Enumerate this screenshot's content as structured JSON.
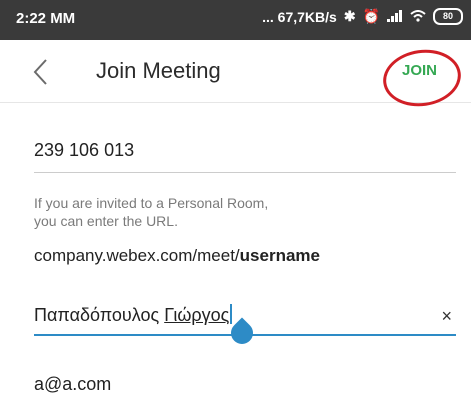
{
  "status_bar": {
    "time": "2:22 MM",
    "network_info": "... 67,7KB/s",
    "battery": "80"
  },
  "header": {
    "back_icon": "chevron-left-icon",
    "title": "Join Meeting",
    "join_label": "JOIN",
    "join_highlight_color": "#d11f26",
    "join_color": "#35a853"
  },
  "form": {
    "meeting_number": "239 106 013",
    "hint_line1": "If you are invited to a Personal Room,",
    "hint_line2": "you can enter the URL.",
    "url_prefix": "company.webex.com/meet/",
    "url_bold": "username",
    "name_part1": "Παπαδόπουλος ",
    "name_part2": "Γιώργος",
    "clear_label": "×",
    "email": "a@a.com",
    "accent_color": "#2d8bc6"
  }
}
